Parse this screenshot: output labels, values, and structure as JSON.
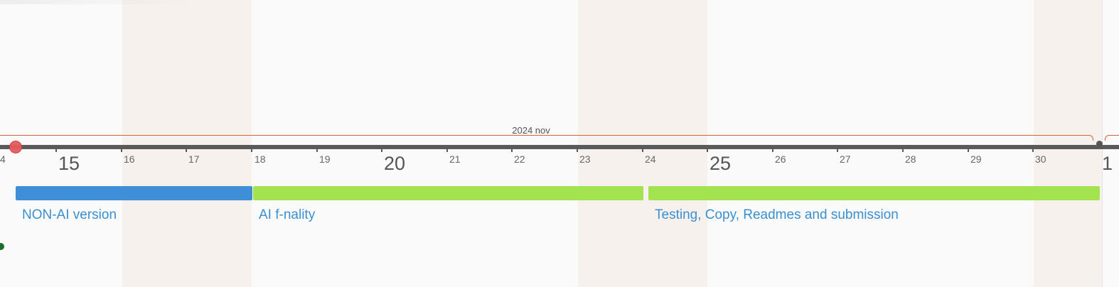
{
  "timeline": {
    "month_label": "2024 nov",
    "day_labels": {
      "d14": "4",
      "d15": "15",
      "d16": "16",
      "d17": "17",
      "d18": "18",
      "d19": "19",
      "d20": "20",
      "d21": "21",
      "d22": "22",
      "d23": "23",
      "d24": "24",
      "d25": "25",
      "d26": "26",
      "d27": "27",
      "d28": "28",
      "d29": "29",
      "d30": "30",
      "d1": "1"
    },
    "tasks": [
      {
        "label": "NON-AI version",
        "color": "#3e8fd6"
      },
      {
        "label": "AI f-nality",
        "color": "#a3e34f"
      },
      {
        "label": "Testing, Copy, Readmes and submission",
        "color": "#a3e34f"
      }
    ],
    "colors": {
      "axis": "#5a5a5a",
      "month_bracket": "#d9603a",
      "today_marker": "#e85a5a",
      "task_text": "#3a8fd1",
      "weekend_band": "#f7f1ee"
    }
  }
}
